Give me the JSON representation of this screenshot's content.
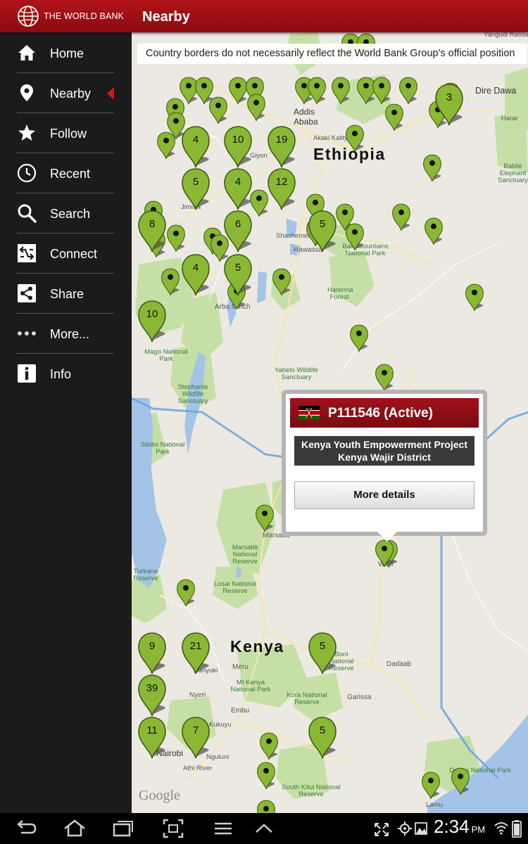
{
  "app": {
    "brand": "THE WORLD BANK",
    "page_title": "Nearby"
  },
  "sidebar": {
    "items": [
      {
        "label": "Home",
        "icon": "home-icon"
      },
      {
        "label": "Nearby",
        "icon": "location-pin-icon",
        "active": true
      },
      {
        "label": "Follow",
        "icon": "star-icon"
      },
      {
        "label": "Recent",
        "icon": "clock-icon"
      },
      {
        "label": "Search",
        "icon": "search-icon"
      },
      {
        "label": "Connect",
        "icon": "connect-icon"
      },
      {
        "label": "Share",
        "icon": "share-icon"
      },
      {
        "label": "More...",
        "icon": "more-dots-icon"
      },
      {
        "label": "Info",
        "icon": "info-icon"
      }
    ]
  },
  "map": {
    "disclaimer": "Country borders do not necessarily reflect the World Bank Group's official position",
    "countries": [
      "Ethiopia",
      "Kenya"
    ],
    "cities": [
      "Addis Ababa",
      "Dire Dawa",
      "Harar",
      "Jimma",
      "Shashemene",
      "Hawassa",
      "Arba Minch",
      "Marsabit",
      "Wajir",
      "Meru",
      "Nyeri",
      "Nanyuki",
      "Embu",
      "Nairobi",
      "Garissa",
      "Dadaab",
      "Athi River",
      "Nguluni",
      "Giyon",
      "Akaki Kality",
      "Yangudi Rassa",
      "Kukuyu",
      "Lamu"
    ],
    "places": [
      "Harenna Forest",
      "Mago National Park",
      "Yabelo Wildlife Sanctuary",
      "Stephanie Wildlife Sanctuary",
      "Sibiloi National Park",
      "Marsabit National Reserve",
      "Losai National Reserve",
      "Mt Kenya National Park",
      "Kora National Reserve",
      "South Kitui National Reserve",
      "Bale Mountains National Park",
      "Babile Elephant Sanctuary",
      "Boni National Reserve",
      "Dodori National Park",
      "Turkana Reserve"
    ],
    "attribution": "Google",
    "clusters": [
      "3",
      "4",
      "10",
      "19",
      "5",
      "4",
      "12",
      "6",
      "8",
      "5",
      "4",
      "5",
      "10",
      "9",
      "21",
      "39",
      "11",
      "7",
      "5",
      "5"
    ],
    "marker_color": "#8ab834"
  },
  "popup": {
    "title": "P111546 (Active)",
    "desc_line1": "Kenya Youth Empowerment Project",
    "desc_line2": "Kenya Wajir District",
    "button": "More details"
  },
  "status": {
    "time": "2:34",
    "ampm": "PM"
  }
}
